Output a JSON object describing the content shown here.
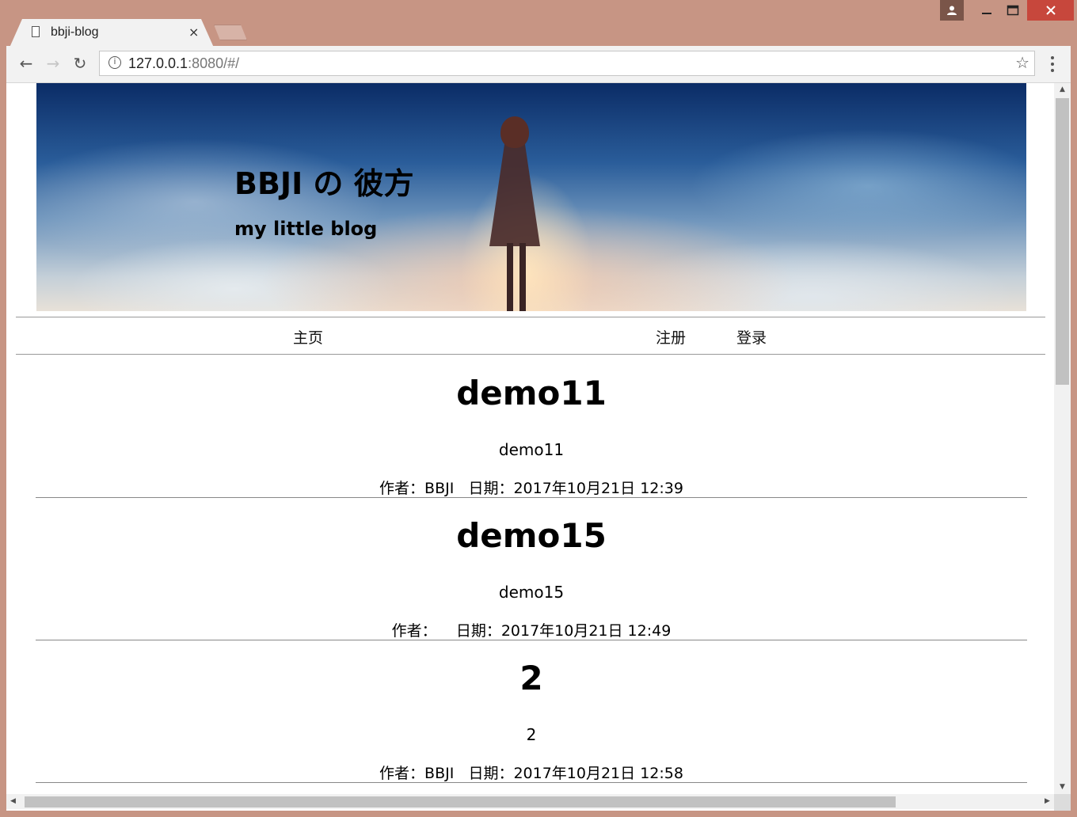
{
  "browser": {
    "tab_title": "bbji-blog",
    "tab_close_glyph": "×",
    "url_host": "127.0.0.1",
    "url_rest": ":8080/#/",
    "info_glyph": "i",
    "back_glyph": "←",
    "forward_glyph": "→",
    "reload_glyph": "↻",
    "star_glyph": "☆",
    "window_min_glyph": "—",
    "window_max_glyph": "☐",
    "window_close_glyph": "✕",
    "icons": [
      "profile-icon",
      "minimize-icon",
      "maximize-icon",
      "close-icon",
      "page-icon",
      "back-arrow-icon",
      "forward-arrow-icon",
      "reload-icon",
      "info-icon",
      "star-icon",
      "menu-dots-icon"
    ]
  },
  "header": {
    "title": "BBJI の 彼方",
    "subtitle": "my little blog"
  },
  "nav": {
    "home": "主页",
    "register": "注册",
    "login": "登录"
  },
  "posts": [
    {
      "title": "demo11",
      "summary": "demo11",
      "meta": "作者：BBJI   日期：2017年10月21日 12:39"
    },
    {
      "title": "demo15",
      "summary": "demo15",
      "meta": "作者：    日期：2017年10月21日 12:49"
    },
    {
      "title": "2",
      "summary": "2",
      "meta": "作者：BBJI   日期：2017年10月21日 12:58"
    }
  ],
  "scrollbar": {
    "up_glyph": "▲",
    "down_glyph": "▼",
    "left_glyph": "◀",
    "right_glyph": "▶"
  },
  "colors": {
    "window_frame": "#c79584",
    "close_button": "#c7473c",
    "toolbar": "#f2f2f2",
    "divider": "#888888"
  }
}
